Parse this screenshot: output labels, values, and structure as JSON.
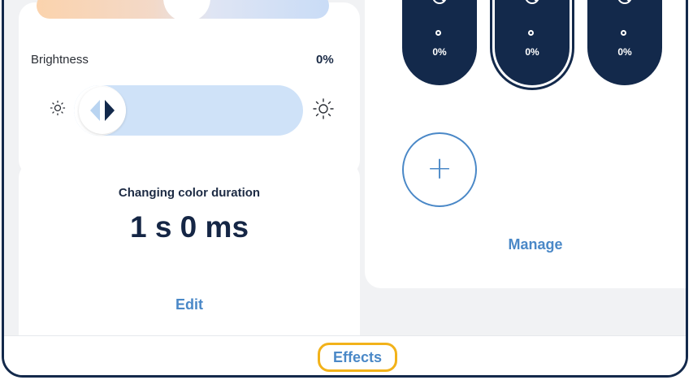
{
  "brightness": {
    "label": "Brightness",
    "value": "0%",
    "slider_level": 0
  },
  "duration": {
    "title": "Changing color duration",
    "value": "1 s 0 ms",
    "edit_label": "Edit"
  },
  "colors": {
    "pills": [
      {
        "percent": "0%",
        "selected": false
      },
      {
        "percent": "0%",
        "selected": true
      },
      {
        "percent": "0%",
        "selected": false
      }
    ],
    "add_symbol": "+",
    "manage_label": "Manage"
  },
  "bottom_nav": {
    "effects_label": "Effects"
  },
  "theme": {
    "navy": "#13294b",
    "accent_blue": "#4a88c7",
    "highlight": "#f2b21a",
    "track": "#cfe2f8"
  }
}
